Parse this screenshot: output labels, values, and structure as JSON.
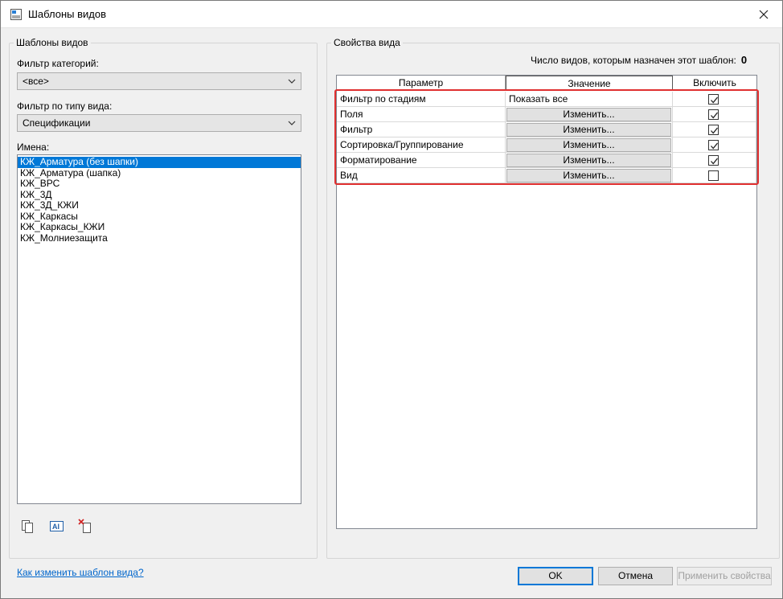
{
  "window": {
    "title": "Шаблоны видов"
  },
  "left_panel": {
    "group_label": "Шаблоны видов",
    "category_filter": {
      "label": "Фильтр категорий:",
      "value": "<все>"
    },
    "view_type_filter": {
      "label": "Фильтр по типу вида:",
      "value": "Спецификации"
    },
    "names": {
      "label": "Имена:",
      "items": [
        "КЖ_Арматура (без шапки)",
        "КЖ_Арматура (шапка)",
        "КЖ_ВРС",
        "КЖ_3Д",
        "КЖ_3Д_КЖИ",
        "КЖ_Каркасы",
        "КЖ_Каркасы_КЖИ",
        "КЖ_Молниезащита"
      ],
      "selected_index": 0
    },
    "tools": {
      "duplicate": "duplicate-icon",
      "rename": "rename-icon",
      "delete": "delete-icon"
    },
    "help_link": "Как изменить шаблон вида?"
  },
  "right_panel": {
    "group_label": "Свойства вида",
    "assigned_count_label": "Число видов, которым назначен этот шаблон:",
    "assigned_count": "0",
    "columns": [
      "Параметр",
      "Значение",
      "Включить"
    ],
    "rows": [
      {
        "param": "Фильтр по стадиям",
        "value": "Показать все",
        "is_button": false,
        "checked": true
      },
      {
        "param": "Поля",
        "value": "Изменить...",
        "is_button": true,
        "checked": true
      },
      {
        "param": "Фильтр",
        "value": "Изменить...",
        "is_button": true,
        "checked": true
      },
      {
        "param": "Сортировка/Группирование",
        "value": "Изменить...",
        "is_button": true,
        "checked": true
      },
      {
        "param": "Форматирование",
        "value": "Изменить...",
        "is_button": true,
        "checked": true
      },
      {
        "param": "Вид",
        "value": "Изменить...",
        "is_button": true,
        "checked": false
      }
    ]
  },
  "footer": {
    "ok": "OK",
    "cancel": "Отмена",
    "apply": "Применить свойства"
  },
  "colors": {
    "selection": "#0078d7",
    "highlight": "#e03030",
    "link": "#0066cc"
  }
}
